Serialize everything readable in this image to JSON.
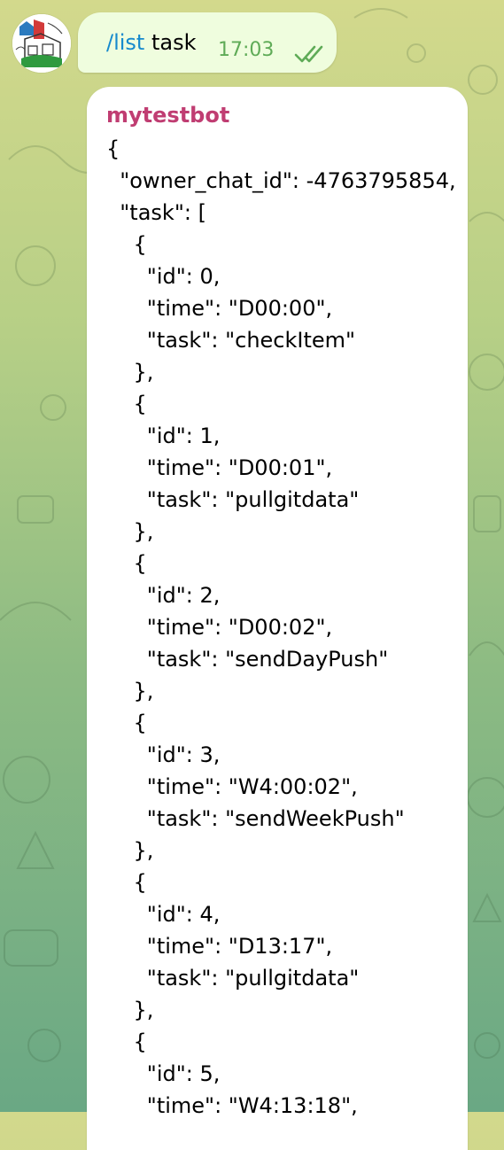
{
  "chat": {
    "outgoing": {
      "command": "/list",
      "argument": " task",
      "time": "17:03",
      "status_icon": "double-check-icon"
    },
    "incoming": {
      "sender": "mytestbot",
      "lines": [
        "{",
        "  \"owner_chat_id\": -4763795854,",
        "  \"task\": [",
        "    {",
        "      \"id\": 0,",
        "      \"time\": \"D00:00\",",
        "      \"task\": \"checkItem\"",
        "    },",
        "    {",
        "      \"id\": 1,",
        "      \"time\": \"D00:01\",",
        "      \"task\": \"pullgitdata\"",
        "    },",
        "    {",
        "      \"id\": 2,",
        "      \"time\": \"D00:02\",",
        "      \"task\": \"sendDayPush\"",
        "    },",
        "    {",
        "      \"id\": 3,",
        "      \"time\": \"W4:00:02\",",
        "      \"task\": \"sendWeekPush\"",
        "    },",
        "    {",
        "      \"id\": 4,",
        "      \"time\": \"D13:17\",",
        "      \"task\": \"pullgitdata\"",
        "    },",
        "    {",
        "      \"id\": 5,",
        "      \"time\": \"W4:13:18\","
      ]
    }
  },
  "colors": {
    "outgoing_bubble": "#effdde",
    "command_link": "#168acd",
    "time_green": "#5fab57",
    "sender_name": "#c03d72"
  }
}
